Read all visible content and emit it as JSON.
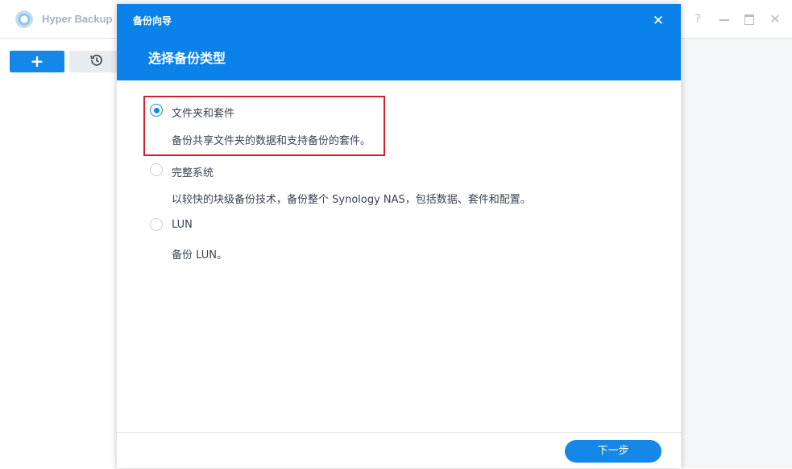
{
  "app": {
    "title": "Hyper Backup",
    "window_controls": {
      "help": "?",
      "close": "✕"
    },
    "toolbar": {
      "add_label": "+",
      "history_icon": "history-icon"
    }
  },
  "dialog": {
    "caption": "备份向导",
    "close_label": "✕",
    "heading": "选择备份类型",
    "options": [
      {
        "label": "文件夹和套件",
        "description": "备份共享文件夹的数据和支持备份的套件。",
        "checked": true
      },
      {
        "label": "完整系统",
        "description": "以较快的块级备份技术，备份整个 Synology NAS，包括数据、套件和配置。",
        "checked": false
      },
      {
        "label": "LUN",
        "description": "备份 LUN。",
        "checked": false
      }
    ],
    "next_label": "下一步"
  },
  "colors": {
    "accent": "#0b81ea",
    "highlight": "#d3212c"
  }
}
